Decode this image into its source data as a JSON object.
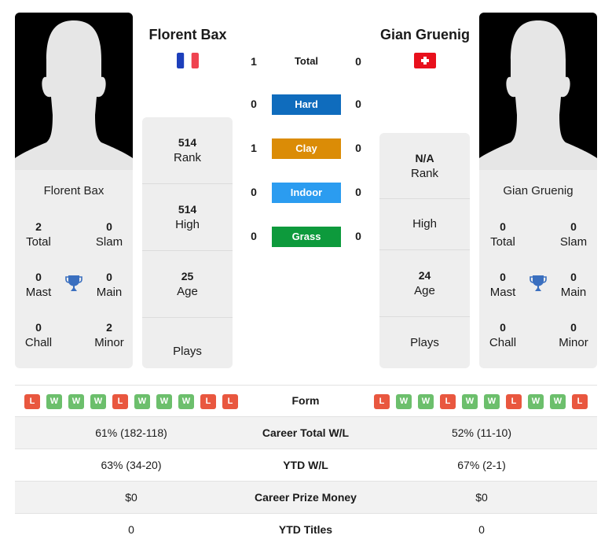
{
  "colors": {
    "hard": "#0f6cbd",
    "clay": "#db8c06",
    "indoor": "#2b9cf0",
    "grass": "#0d9a3c",
    "loss": "#e9573f",
    "win": "#6cbf6c",
    "trophy": "#3a6fbf",
    "panel": "#eeeeee"
  },
  "player1": {
    "name": "Florent Bax",
    "country": "France",
    "flag_icon": "flag-france-icon",
    "card_name": "Florent Bax",
    "titles": {
      "total": "2",
      "total_label": "Total",
      "slam": "0",
      "slam_label": "Slam",
      "mast": "0",
      "mast_label": "Mast",
      "main": "0",
      "main_label": "Main",
      "chall": "0",
      "chall_label": "Chall",
      "minor": "2",
      "minor_label": "Minor"
    },
    "stats": {
      "rank": "514",
      "rank_label": "Rank",
      "high": "514",
      "high_label": "High",
      "age": "25",
      "age_label": "Age",
      "plays": "",
      "plays_label": "Plays"
    },
    "form": [
      "L",
      "W",
      "W",
      "W",
      "L",
      "W",
      "W",
      "W",
      "L",
      "L"
    ]
  },
  "player2": {
    "name": "Gian Gruenig",
    "country": "Switzerland",
    "flag_icon": "flag-switzerland-icon",
    "card_name": "Gian Gruenig",
    "titles": {
      "total": "0",
      "total_label": "Total",
      "slam": "0",
      "slam_label": "Slam",
      "mast": "0",
      "mast_label": "Mast",
      "main": "0",
      "main_label": "Main",
      "chall": "0",
      "chall_label": "Chall",
      "minor": "0",
      "minor_label": "Minor"
    },
    "stats": {
      "rank": "N/A",
      "rank_label": "Rank",
      "high": "",
      "high_label": "High",
      "age": "24",
      "age_label": "Age",
      "plays": "",
      "plays_label": "Plays"
    },
    "form": [
      "L",
      "W",
      "W",
      "L",
      "W",
      "W",
      "L",
      "W",
      "W",
      "L"
    ]
  },
  "h2h": {
    "total": {
      "label": "Total",
      "p1": "1",
      "p2": "0"
    },
    "surfaces": [
      {
        "label": "Hard",
        "p1": "0",
        "p2": "0",
        "key": "hard"
      },
      {
        "label": "Clay",
        "p1": "1",
        "p2": "0",
        "key": "clay"
      },
      {
        "label": "Indoor",
        "p1": "0",
        "p2": "0",
        "key": "indoor"
      },
      {
        "label": "Grass",
        "p1": "0",
        "p2": "0",
        "key": "grass"
      }
    ]
  },
  "form_label": "Form",
  "comparison": [
    {
      "label": "Career Total W/L",
      "p1": "61% (182-118)",
      "p2": "52% (11-10)"
    },
    {
      "label": "YTD W/L",
      "p1": "63% (34-20)",
      "p2": "67% (2-1)"
    },
    {
      "label": "Career Prize Money",
      "p1": "$0",
      "p2": "$0"
    },
    {
      "label": "YTD Titles",
      "p1": "0",
      "p2": "0"
    }
  ]
}
